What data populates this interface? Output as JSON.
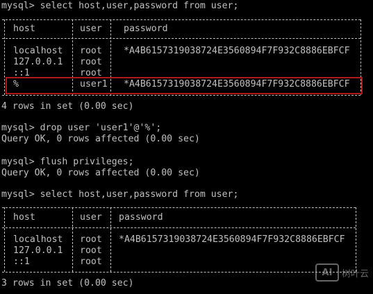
{
  "console": {
    "cmd1": "mysql> select host,user,password from user;",
    "result1": "4 rows in set (0.00 sec)",
    "cmd2": "mysql> drop user 'user1'@'%';",
    "result2": "Query OK, 0 rows affected (0.00 sec)",
    "cmd3": "mysql> flush privileges;",
    "result3": "Query OK, 0 rows affected (0.00 sec)",
    "cmd4": "mysql> select host,user,password from user;",
    "result4": "3 rows in set (0.00 sec)"
  },
  "table1": {
    "headers": {
      "host": "host",
      "user": "user",
      "password": "password"
    },
    "rows": [
      {
        "host": "localhost",
        "user": "root",
        "password": "*A4B6157319038724E3560894F7F932C8886EBFCF"
      },
      {
        "host": "127.0.0.1",
        "user": "root",
        "password": ""
      },
      {
        "host": "::1",
        "user": "root",
        "password": ""
      },
      {
        "host": "%",
        "user": "user1",
        "password": "*A4B6157319038724E3560894F7F932C8886EBFCF"
      }
    ]
  },
  "table2": {
    "headers": {
      "host": "host",
      "user": "user",
      "password": "password"
    },
    "rows": [
      {
        "host": "localhost",
        "user": "root",
        "password": "*A4B6157319038724E3560894F7F932C8886EBFCF"
      },
      {
        "host": "127.0.0.1",
        "user": "root",
        "password": ""
      },
      {
        "host": "::1",
        "user": "root",
        "password": ""
      }
    ]
  },
  "watermark": {
    "logo": "AI",
    "text": "树叶云"
  },
  "colors": {
    "background": "#000000",
    "text": "#c0c0c0",
    "highlight": "#b01818"
  }
}
